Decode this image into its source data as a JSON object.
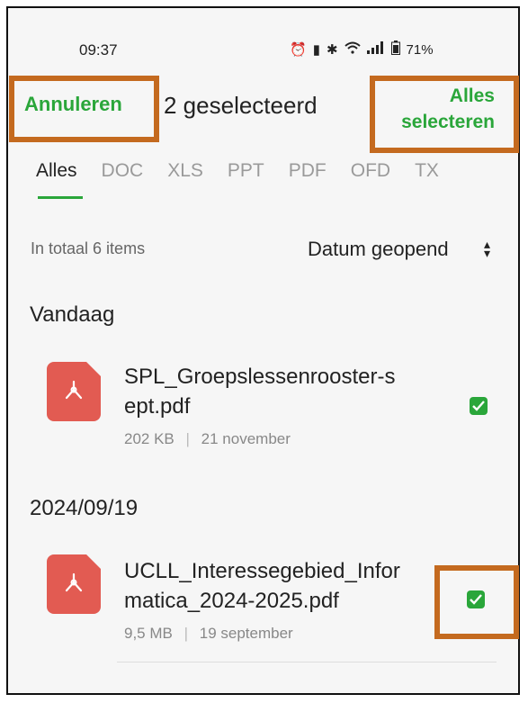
{
  "status_bar": {
    "time": "09:37",
    "battery": "71%",
    "icons": [
      "alarm-icon",
      "vibrate-icon",
      "bluetooth-icon",
      "wifi-icon",
      "signal-icon",
      "battery-icon"
    ]
  },
  "topbar": {
    "cancel_label": "Annuleren",
    "selection_count": "2 geselecteerd",
    "select_all_line1": "Alles",
    "select_all_line2": "selecteren"
  },
  "tabs": [
    {
      "label": "Alles",
      "active": true
    },
    {
      "label": "DOC"
    },
    {
      "label": "XLS"
    },
    {
      "label": "PPT"
    },
    {
      "label": "PDF"
    },
    {
      "label": "OFD"
    },
    {
      "label": "TX"
    }
  ],
  "list_header": {
    "total": "In totaal 6 items",
    "sort_label": "Datum geopend"
  },
  "sections": [
    {
      "title": "Vandaag",
      "files": [
        {
          "name_line1": "SPL_Groepslessenrooster-s",
          "name_line2": "ept.pdf",
          "size": "202 KB",
          "separator": "|",
          "date": "21 november",
          "checked": true
        }
      ]
    },
    {
      "title": "2024/09/19",
      "files": [
        {
          "name_line1": "UCLL_Interessegebied_Infor",
          "name_line2": "matica_2024-2025.pdf",
          "size": "9,5 MB",
          "separator": "|",
          "date": "19 september",
          "checked": true
        }
      ]
    }
  ],
  "colors": {
    "accent": "#2aa63a",
    "pdf": "#e25b52",
    "highlight_box": "#c46a1f"
  }
}
